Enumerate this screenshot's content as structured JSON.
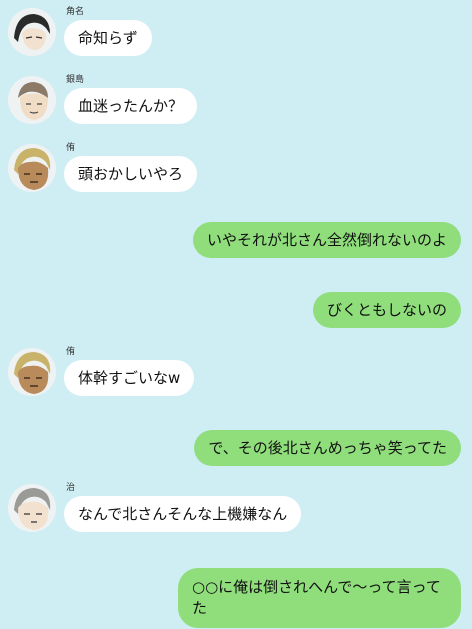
{
  "messages": [
    {
      "side": "in",
      "sender": "角名",
      "avatar": "avatar-suna",
      "text": "命知らず"
    },
    {
      "side": "in",
      "sender": "銀島",
      "avatar": "avatar-ginjima",
      "text": "血迷ったんか？"
    },
    {
      "side": "in",
      "sender": "侑",
      "avatar": "avatar-atsumu",
      "text": "頭おかしいやろ"
    },
    {
      "side": "out",
      "text": "いやそれが北さん全然倒れないのよ"
    },
    {
      "side": "out",
      "text": "びくともしないの"
    },
    {
      "side": "in",
      "sender": "侑",
      "avatar": "avatar-atsumu",
      "text": "体幹すごいなw"
    },
    {
      "side": "out",
      "text": "で、その後北さんめっちゃ笑ってた"
    },
    {
      "side": "in",
      "sender": "治",
      "avatar": "avatar-osamu",
      "text": "なんで北さんそんな上機嫌なん"
    },
    {
      "side": "out",
      "text": "○○に俺は倒されへんで～って言ってた"
    }
  ],
  "colors": {
    "background": "#cfeef4",
    "incoming_bubble": "#ffffff",
    "outgoing_bubble": "#8fde7b"
  }
}
